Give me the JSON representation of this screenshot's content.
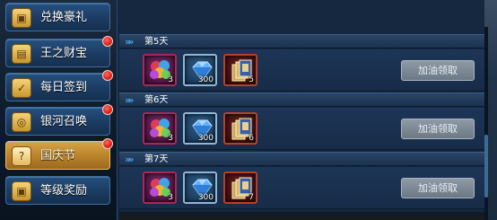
{
  "sidebar": {
    "items": [
      {
        "label": "兑换豪礼",
        "icon": "gift-box-icon",
        "badge": false,
        "active": false
      },
      {
        "label": "王之财宝",
        "icon": "treasure-icon",
        "badge": true,
        "active": false
      },
      {
        "label": "每日签到",
        "icon": "checkin-icon",
        "badge": true,
        "active": false
      },
      {
        "label": "银河召唤",
        "icon": "summon-icon",
        "badge": true,
        "active": false
      },
      {
        "label": "国庆节",
        "icon": "question-scroll-icon",
        "badge": true,
        "active": true
      },
      {
        "label": "等级奖励",
        "icon": "gift-box-icon",
        "badge": false,
        "active": false
      }
    ]
  },
  "days": [
    {
      "label": "第5天",
      "items": [
        {
          "icon": "balloons-icon",
          "count": "3",
          "rarity": "purple"
        },
        {
          "icon": "blue-diamond-icon",
          "count": "300",
          "rarity": "blue"
        },
        {
          "icon": "card-pack-icon",
          "count": "5",
          "rarity": "red"
        }
      ],
      "button": "加油领取"
    },
    {
      "label": "第6天",
      "items": [
        {
          "icon": "balloons-icon",
          "count": "3",
          "rarity": "purple"
        },
        {
          "icon": "blue-diamond-icon",
          "count": "300",
          "rarity": "blue"
        },
        {
          "icon": "card-pack-icon",
          "count": "6",
          "rarity": "red"
        }
      ],
      "button": "加油领取"
    },
    {
      "label": "第7天",
      "items": [
        {
          "icon": "balloons-icon",
          "count": "3",
          "rarity": "purple"
        },
        {
          "icon": "blue-diamond-icon",
          "count": "300",
          "rarity": "blue"
        },
        {
          "icon": "card-pack-icon",
          "count": "7",
          "rarity": "red"
        }
      ],
      "button": "加油领取"
    }
  ],
  "colors": {
    "accent_blue": "#4fb4ff",
    "active_tab": "#d7a445",
    "badge_red": "#d8231a",
    "disabled_button": "#7f8b97"
  }
}
